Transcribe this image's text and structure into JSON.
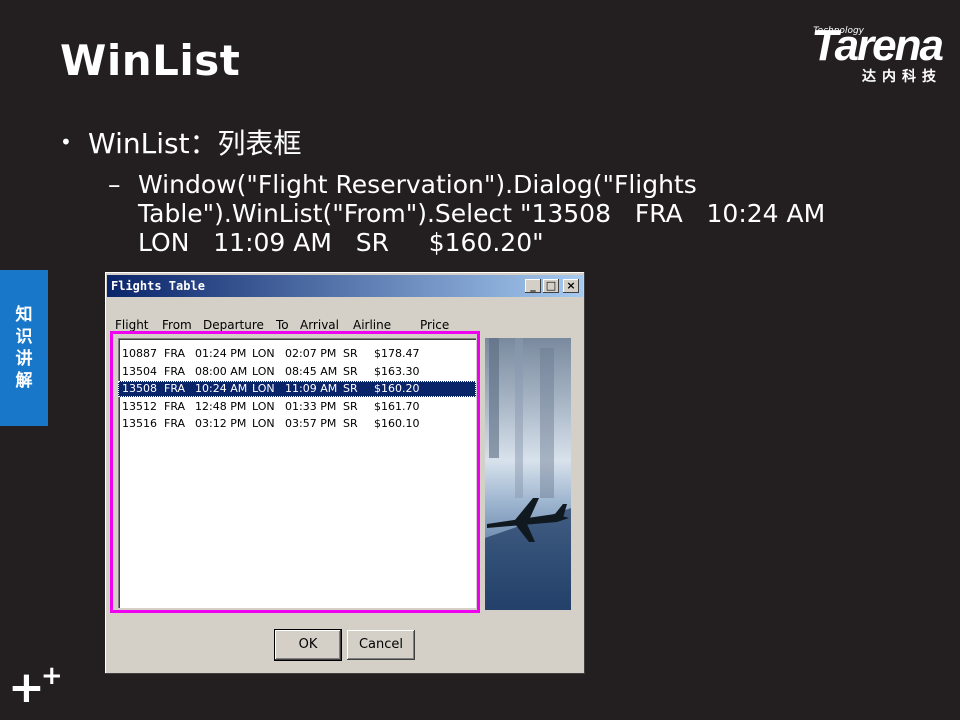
{
  "slide": {
    "title": "WinList",
    "bullet": "WinList：列表框",
    "sub_dash": "–",
    "sub_code": "Window(\"Flight Reservation\").Dialog(\"Flights Table\").WinList(\"From\").Select \"13508   FRA   10:24 AM   LON   11:09 AM   SR     $160.20\""
  },
  "logo": {
    "small": "Technology",
    "name": "Tarena",
    "cn": "达内科技"
  },
  "side_tab": [
    "知",
    "识",
    "讲",
    "解"
  ],
  "plus_mark": "+",
  "dialog": {
    "title": "Flights Table",
    "minimize": "_",
    "maximize": "□",
    "close": "×",
    "headers": [
      "Flight",
      "From",
      "Departure",
      "To",
      "Arrival",
      "Airline",
      "Price"
    ],
    "rows": [
      [
        "10887",
        "FRA",
        "01:24 PM",
        "LON",
        "02:07 PM",
        "SR",
        "$178.47"
      ],
      [
        "13504",
        "FRA",
        "08:00 AM",
        "LON",
        "08:45 AM",
        "SR",
        "$163.30"
      ],
      [
        "13508",
        "FRA",
        "10:24 AM",
        "LON",
        "11:09 AM",
        "SR",
        "$160.20"
      ],
      [
        "13512",
        "FRA",
        "12:48 PM",
        "LON",
        "01:33 PM",
        "SR",
        "$161.70"
      ],
      [
        "13516",
        "FRA",
        "03:12 PM",
        "LON",
        "03:57 PM",
        "SR",
        "$160.10"
      ]
    ],
    "selected_index": 2,
    "ok_label": "OK",
    "cancel_label": "Cancel"
  },
  "colors": {
    "background": "#231f20",
    "accent_tab": "#1877c9",
    "highlight_border": "#f000f0",
    "selection": "#0a246a"
  }
}
